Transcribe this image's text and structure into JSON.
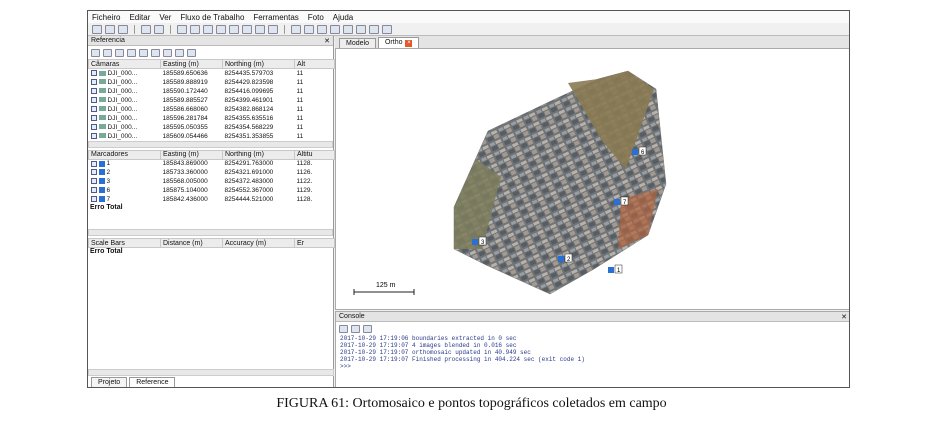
{
  "menu": [
    "Ficheiro",
    "Editar",
    "Ver",
    "Fluxo de Trabalho",
    "Ferramentas",
    "Foto",
    "Ajuda"
  ],
  "referencePane": {
    "title": "Referencia",
    "cameras": {
      "headers": [
        "Câmaras",
        "Easting (m)",
        "Northing (m)",
        "Alt"
      ],
      "rows": [
        {
          "name": "DJI_000...",
          "e": "185589.650636",
          "n": "8254435.579703",
          "a": "11"
        },
        {
          "name": "DJI_000...",
          "e": "185589.888919",
          "n": "8254429.823598",
          "a": "11"
        },
        {
          "name": "DJI_000...",
          "e": "185590.172440",
          "n": "8254416.099695",
          "a": "11"
        },
        {
          "name": "DJI_000...",
          "e": "185589.885527",
          "n": "8254399.461901",
          "a": "11"
        },
        {
          "name": "DJI_000...",
          "e": "185586.668060",
          "n": "8254382.868124",
          "a": "11"
        },
        {
          "name": "DJI_000...",
          "e": "185596.281784",
          "n": "8254355.635516",
          "a": "11"
        },
        {
          "name": "DJI_000...",
          "e": "185595.050355",
          "n": "8254354.568229",
          "a": "11"
        },
        {
          "name": "DJI_000...",
          "e": "185609.054466",
          "n": "8254351.353855",
          "a": "11"
        }
      ]
    },
    "markers": {
      "headers": [
        "Marcadores",
        "Easting (m)",
        "Northing (m)",
        "Altitu"
      ],
      "rows": [
        {
          "name": "1",
          "e": "185843.869000",
          "n": "8254291.763000",
          "a": "1128."
        },
        {
          "name": "2",
          "e": "185733.360000",
          "n": "8254321.691000",
          "a": "1126."
        },
        {
          "name": "3",
          "e": "185568.005000",
          "n": "8254372.483000",
          "a": "1122."
        },
        {
          "name": "6",
          "e": "185875.104000",
          "n": "8254552.367000",
          "a": "1129."
        },
        {
          "name": "7",
          "e": "185842.436000",
          "n": "8254444.521000",
          "a": "1128."
        }
      ],
      "total": "Erro Total"
    },
    "scalebars": {
      "headers": [
        "Scale Bars",
        "Distance (m)",
        "Accuracy (m)",
        "Er"
      ],
      "total": "Erro Total"
    },
    "bottomTabs": [
      "Projeto",
      "Reference"
    ]
  },
  "viewTabs": [
    "Modelo",
    "Ortho"
  ],
  "scaleLabel": "125 m",
  "mapMarkers": [
    "6",
    "7",
    "3",
    "2",
    "1"
  ],
  "console": {
    "title": "Console",
    "lines": [
      "2017-10-29 17:19:06 boundaries extracted in 0 sec",
      "2017-10-29 17:19:07 4 images blended in 0.016 sec",
      "2017-10-29 17:19:07 orthomosaic updated in 40.949 sec",
      "2017-10-29 17:19:07 Finished processing in 404.224 sec (exit code 1)",
      ">>>"
    ]
  },
  "caption": "FIGURA 61: Ortomosaico e pontos topográficos coletados em campo"
}
